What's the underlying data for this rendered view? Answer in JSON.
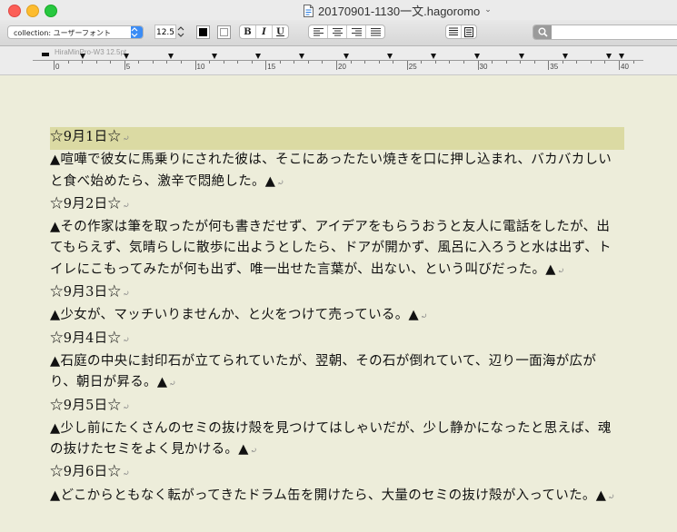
{
  "window": {
    "title": "20170901-1130一文.hagoromo",
    "title_chevron": "⌄"
  },
  "toolbar": {
    "collection_label": "collection: ユーザーフォント",
    "font_size": "12.5",
    "bold_label": "B",
    "italic_label": "I",
    "underline_label": "U"
  },
  "ruler": {
    "font_name": "HiraMinPro-W3 12.5pt.",
    "numbers": [
      "0",
      "5",
      "10",
      "15",
      "20",
      "25",
      "30",
      "35",
      "40"
    ]
  },
  "document": {
    "paragraph_mark": "⤾",
    "paragraphs": [
      {
        "text": "☆9月1日☆",
        "highlighted": true
      },
      {
        "text": "▲喧嘩で彼女に馬乗りにされた彼は、そこにあったたい焼きを口に押し込まれ、バカバカしいと食べ始めたら、激辛で悶絶した。▲"
      },
      {
        "text": "☆9月2日☆"
      },
      {
        "text": "▲その作家は筆を取ったが何も書きだせず、アイデアをもらうおうと友人に電話をしたが、出てもらえず、気晴らしに散歩に出ようとしたら、ドアが開かず、風呂に入ろうと水は出ず、トイレにこもってみたが何も出ず、唯一出せた言葉が、出ない、という叫びだった。▲"
      },
      {
        "text": "☆9月3日☆"
      },
      {
        "text": "▲少女が、マッチいりませんか、と火をつけて売っている。▲"
      },
      {
        "text": "☆9月4日☆"
      },
      {
        "text": "▲石庭の中央に封印石が立てられていたが、翌朝、その石が倒れていて、辺り一面海が広がり、朝日が昇る。▲"
      },
      {
        "text": "☆9月5日☆"
      },
      {
        "text": "▲少し前にたくさんのセミの抜け殻を見つけてはしゃいだが、少し静かになったと思えば、魂の抜けたセミをよく見かける。▲"
      },
      {
        "text": "☆9月6日☆"
      },
      {
        "text": "▲どこからともなく転がってきたドラム缶を開けたら、大量のセミの抜け殻が入っていた。▲"
      }
    ]
  },
  "colors": {
    "page_background": "#ededda",
    "highlight": "#dbdaa3",
    "accent": "#3b8cf5"
  }
}
